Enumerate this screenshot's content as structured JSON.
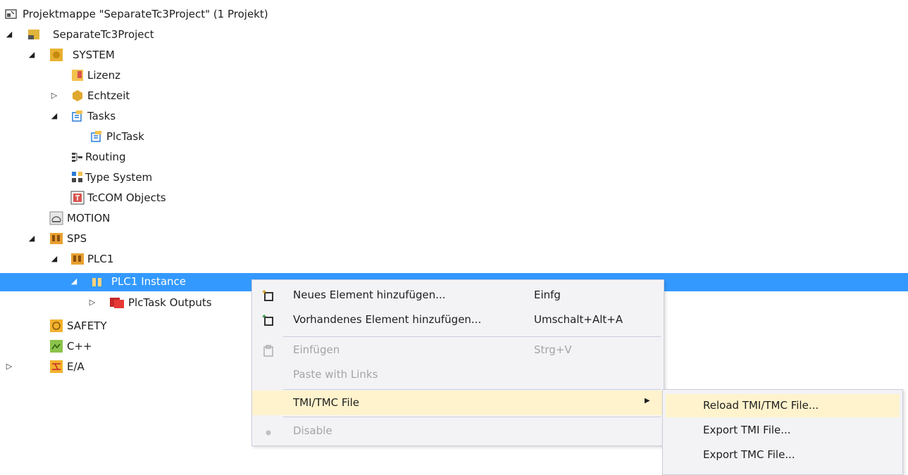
{
  "tree": {
    "solution": "Projektmappe \"SeparateTc3Project\" (1 Projekt)",
    "items": [
      {
        "label": "SeparateTc3Project"
      },
      {
        "label": "SYSTEM"
      },
      {
        "label": "Lizenz"
      },
      {
        "label": "Echtzeit"
      },
      {
        "label": "Tasks"
      },
      {
        "label": "PlcTask"
      },
      {
        "label": "Routing"
      },
      {
        "label": "Type System"
      },
      {
        "label": "TcCOM Objects"
      },
      {
        "label": "MOTION"
      },
      {
        "label": "SPS"
      },
      {
        "label": "PLC1"
      },
      {
        "label": "PLC1 Instance"
      },
      {
        "label": "PlcTask Outputs"
      },
      {
        "label": "SAFETY"
      },
      {
        "label": "C++"
      },
      {
        "label": "E/A"
      }
    ]
  },
  "context_menu": {
    "items": [
      {
        "label": "Neues Element hinzufügen...",
        "shortcut": "Einfg"
      },
      {
        "label": "Vorhandenes Element hinzufügen...",
        "shortcut": "Umschalt+Alt+A"
      },
      {
        "label": "Einfügen",
        "shortcut": "Strg+V"
      },
      {
        "label": "Paste with Links",
        "shortcut": ""
      },
      {
        "label": "TMI/TMC File",
        "shortcut": ""
      },
      {
        "label": "Disable",
        "shortcut": ""
      }
    ]
  },
  "submenu": {
    "items": [
      {
        "label": "Reload TMI/TMC File..."
      },
      {
        "label": "Export TMI File..."
      },
      {
        "label": "Export TMC File..."
      }
    ]
  },
  "colors": {
    "selection": "#3399ff",
    "menu_bg": "#f3f3f6",
    "menu_highlight": "#fff3cd"
  }
}
